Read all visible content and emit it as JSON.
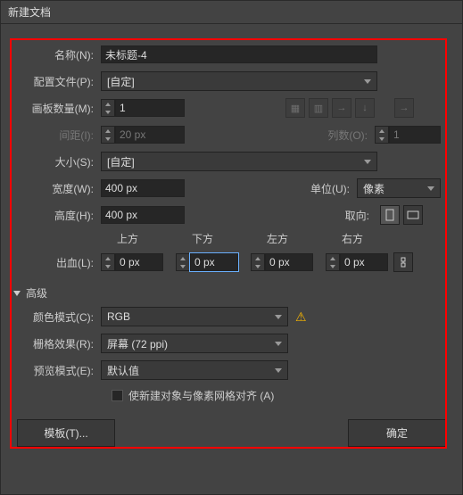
{
  "title": "新建文档",
  "fields": {
    "name_label": "名称(N):",
    "name_value": "未标题-4",
    "profile_label": "配置文件(P):",
    "profile_value": "[自定]",
    "artboards_label": "画板数量(M):",
    "artboards_value": "1",
    "spacing_label": "间距(I):",
    "spacing_value": "20 px",
    "columns_label": "列数(O):",
    "columns_value": "1",
    "size_label": "大小(S):",
    "size_value": "[自定]",
    "width_label": "宽度(W):",
    "width_value": "400 px",
    "units_label": "单位(U):",
    "units_value": "像素",
    "height_label": "高度(H):",
    "height_value": "400 px",
    "orient_label": "取向:",
    "bleed_label": "出血(L):",
    "bleed_top_label": "上方",
    "bleed_bottom_label": "下方",
    "bleed_left_label": "左方",
    "bleed_right_label": "右方",
    "bleed_top": "0 px",
    "bleed_bottom": "0 px",
    "bleed_left": "0 px",
    "bleed_right": "0 px"
  },
  "advanced": {
    "header": "高级",
    "colormode_label": "颜色模式(C):",
    "colormode_value": "RGB",
    "raster_label": "栅格效果(R):",
    "raster_value": "屏幕 (72 ppi)",
    "preview_label": "预览模式(E):",
    "preview_value": "默认值",
    "align_checkbox": "使新建对象与像素网格对齐 (A)"
  },
  "buttons": {
    "templates": "模板(T)...",
    "ok": "确定"
  }
}
